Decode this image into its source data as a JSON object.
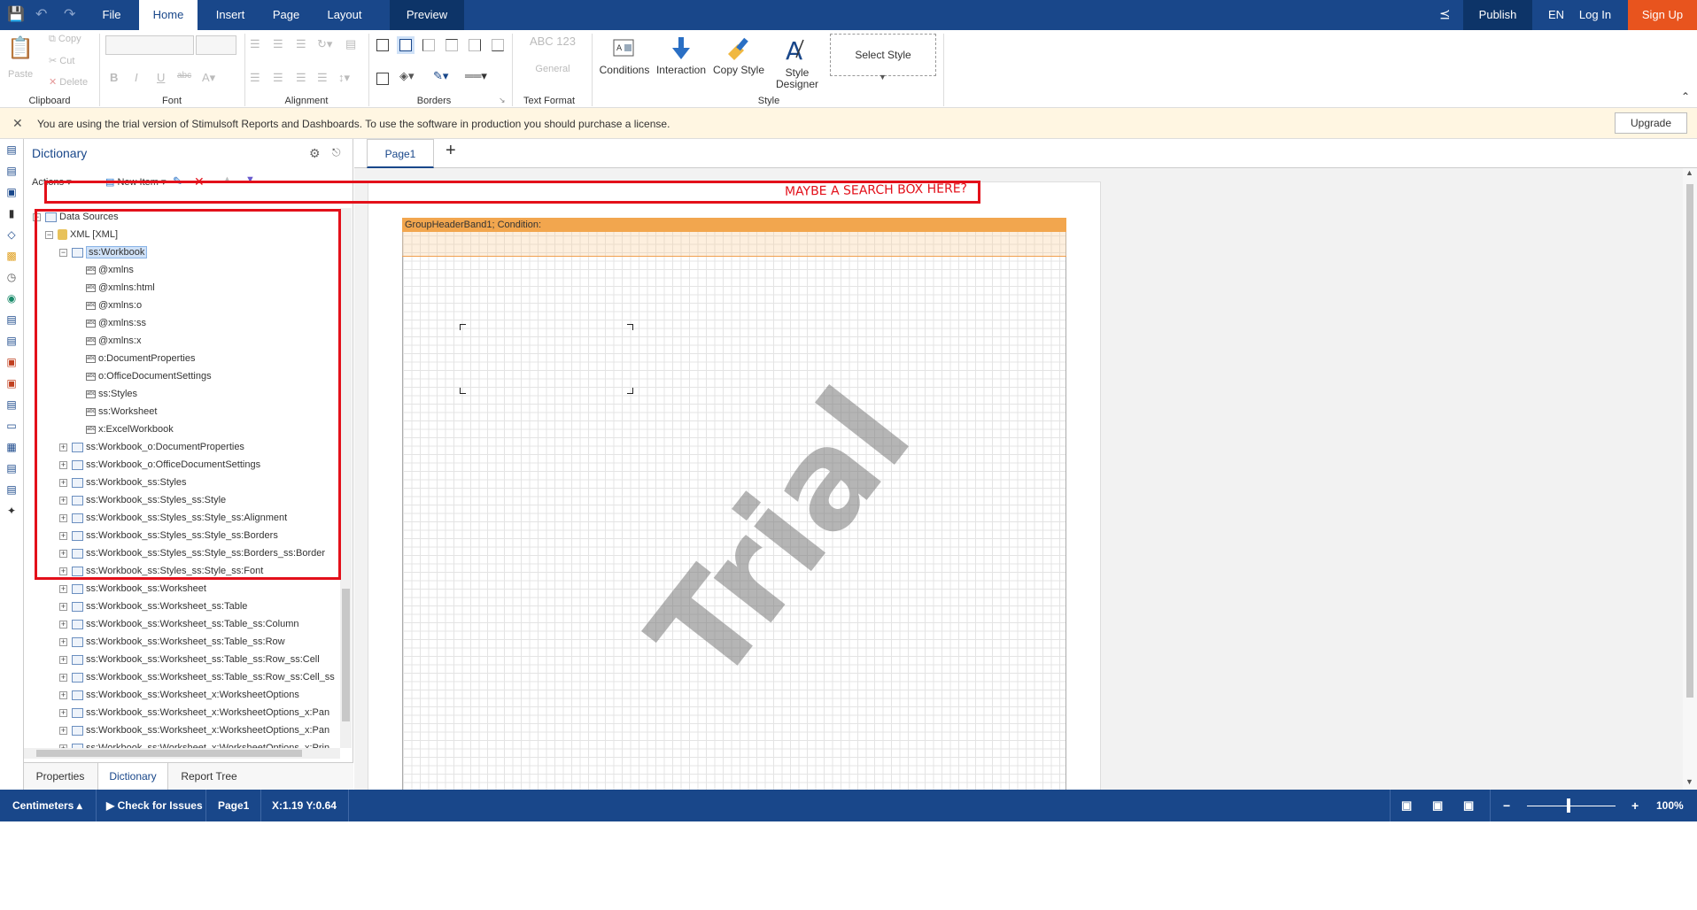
{
  "tabs": {
    "file": "File",
    "home": "Home",
    "insert": "Insert",
    "page": "Page",
    "layout": "Layout",
    "preview": "Preview"
  },
  "topright": {
    "publish": "Publish",
    "lang": "EN",
    "login": "Log In",
    "signup": "Sign Up"
  },
  "ribbon": {
    "clipboard": {
      "label": "Clipboard",
      "paste": "Paste",
      "copy": "Copy",
      "cut": "Cut",
      "delete": "Delete"
    },
    "font_label": "Font",
    "alignment_label": "Alignment",
    "borders_label": "Borders",
    "textformat": {
      "label": "Text Format",
      "general": "General",
      "sample": "ABC 123"
    },
    "style": {
      "label": "Style",
      "conditions": "Conditions",
      "interaction": "Interaction",
      "copy_style": "Copy Style",
      "style_designer": "Style Designer",
      "select_style": "Select Style"
    }
  },
  "trial": {
    "message": "You are using the trial version of Stimulsoft Reports and Dashboards. To use the software in production you should purchase a license.",
    "upgrade": "Upgrade"
  },
  "dictionary": {
    "title": "Dictionary",
    "actions": "Actions",
    "new_item": "New Item",
    "tree": [
      {
        "label": "Data Sources",
        "level": 0,
        "toggle": "−",
        "icon": "table"
      },
      {
        "label": "XML [XML]",
        "level": 1,
        "toggle": "−",
        "icon": "db"
      },
      {
        "label": "ss:Workbook",
        "level": 2,
        "toggle": "−",
        "icon": "table",
        "selected": true
      },
      {
        "label": "@xmlns",
        "level": 3,
        "icon": "field"
      },
      {
        "label": "@xmlns:html",
        "level": 3,
        "icon": "field"
      },
      {
        "label": "@xmlns:o",
        "level": 3,
        "icon": "field"
      },
      {
        "label": "@xmlns:ss",
        "level": 3,
        "icon": "field"
      },
      {
        "label": "@xmlns:x",
        "level": 3,
        "icon": "field"
      },
      {
        "label": "o:DocumentProperties",
        "level": 3,
        "icon": "field"
      },
      {
        "label": "o:OfficeDocumentSettings",
        "level": 3,
        "icon": "field"
      },
      {
        "label": "ss:Styles",
        "level": 3,
        "icon": "field"
      },
      {
        "label": "ss:Worksheet",
        "level": 3,
        "icon": "field"
      },
      {
        "label": "x:ExcelWorkbook",
        "level": 3,
        "icon": "field"
      },
      {
        "label": "ss:Workbook_o:DocumentProperties",
        "level": 2,
        "toggle": "+",
        "icon": "table"
      },
      {
        "label": "ss:Workbook_o:OfficeDocumentSettings",
        "level": 2,
        "toggle": "+",
        "icon": "table"
      },
      {
        "label": "ss:Workbook_ss:Styles",
        "level": 2,
        "toggle": "+",
        "icon": "table"
      },
      {
        "label": "ss:Workbook_ss:Styles_ss:Style",
        "level": 2,
        "toggle": "+",
        "icon": "table"
      },
      {
        "label": "ss:Workbook_ss:Styles_ss:Style_ss:Alignment",
        "level": 2,
        "toggle": "+",
        "icon": "table"
      },
      {
        "label": "ss:Workbook_ss:Styles_ss:Style_ss:Borders",
        "level": 2,
        "toggle": "+",
        "icon": "table"
      },
      {
        "label": "ss:Workbook_ss:Styles_ss:Style_ss:Borders_ss:Border",
        "level": 2,
        "toggle": "+",
        "icon": "table"
      },
      {
        "label": "ss:Workbook_ss:Styles_ss:Style_ss:Font",
        "level": 2,
        "toggle": "+",
        "icon": "table"
      },
      {
        "label": "ss:Workbook_ss:Worksheet",
        "level": 2,
        "toggle": "+",
        "icon": "table"
      },
      {
        "label": "ss:Workbook_ss:Worksheet_ss:Table",
        "level": 2,
        "toggle": "+",
        "icon": "table"
      },
      {
        "label": "ss:Workbook_ss:Worksheet_ss:Table_ss:Column",
        "level": 2,
        "toggle": "+",
        "icon": "table"
      },
      {
        "label": "ss:Workbook_ss:Worksheet_ss:Table_ss:Row",
        "level": 2,
        "toggle": "+",
        "icon": "table"
      },
      {
        "label": "ss:Workbook_ss:Worksheet_ss:Table_ss:Row_ss:Cell",
        "level": 2,
        "toggle": "+",
        "icon": "table"
      },
      {
        "label": "ss:Workbook_ss:Worksheet_ss:Table_ss:Row_ss:Cell_ss",
        "level": 2,
        "toggle": "+",
        "icon": "table"
      },
      {
        "label": "ss:Workbook_ss:Worksheet_x:WorksheetOptions",
        "level": 2,
        "toggle": "+",
        "icon": "table"
      },
      {
        "label": "ss:Workbook_ss:Worksheet_x:WorksheetOptions_x:Pan",
        "level": 2,
        "toggle": "+",
        "icon": "table"
      },
      {
        "label": "ss:Workbook_ss:Worksheet_x:WorksheetOptions_x:Pan",
        "level": 2,
        "toggle": "+",
        "icon": "table"
      },
      {
        "label": "ss:Workbook_ss:Worksheet_x:WorksheetOptions_x:Prin",
        "level": 2,
        "toggle": "+",
        "icon": "table"
      }
    ],
    "bottom_tabs": {
      "properties": "Properties",
      "dictionary": "Dictionary",
      "report_tree": "Report Tree"
    }
  },
  "annotation": "MAYBE A SEARCH BOX HERE?",
  "page_tab": "Page1",
  "band": {
    "title": "GroupHeaderBand1; Condition:"
  },
  "watermark": "Trial",
  "status": {
    "units": "Centimeters",
    "check": "Check for Issues",
    "page": "Page1",
    "coords": "X:1.19 Y:0.64",
    "zoom": "100%"
  },
  "colors": {
    "primary": "#19478a",
    "signup": "#e8541e",
    "trial_bg": "#fff6e2",
    "band": "#f2a64e",
    "annotation": "#e3101a"
  }
}
